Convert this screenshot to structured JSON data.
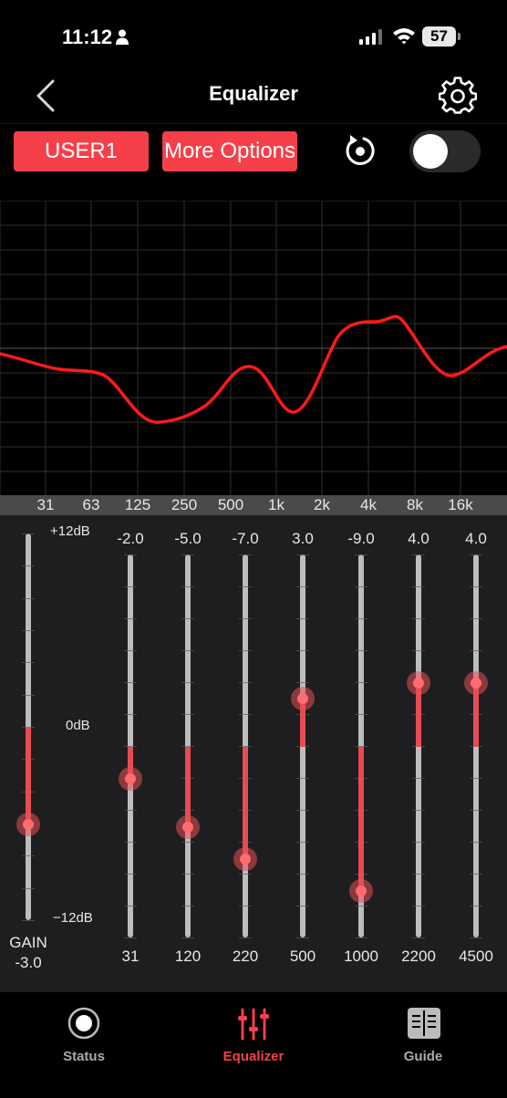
{
  "status": {
    "time": "11:12",
    "battery": "57"
  },
  "nav": {
    "title": "Equalizer"
  },
  "toolbar": {
    "preset_label": "USER1",
    "more_options_label": "More Options",
    "toggle_on": false
  },
  "graph": {
    "freq_labels": [
      "31",
      "63",
      "125",
      "250",
      "500",
      "1k",
      "2k",
      "4k",
      "8k",
      "16k"
    ]
  },
  "scale": {
    "top": "+12dB",
    "mid": "0dB",
    "bottom": "−12dB"
  },
  "gain": {
    "label": "GAIN",
    "value": "-3.0",
    "level": -3.0
  },
  "bands": [
    {
      "freq": "31",
      "value": "-2.0",
      "level": -2.0
    },
    {
      "freq": "120",
      "value": "-5.0",
      "level": -5.0
    },
    {
      "freq": "220",
      "value": "-7.0",
      "level": -7.0
    },
    {
      "freq": "500",
      "value": "3.0",
      "level": 3.0
    },
    {
      "freq": "1000",
      "value": "-9.0",
      "level": -9.0
    },
    {
      "freq": "2200",
      "value": "4.0",
      "level": 4.0
    },
    {
      "freq": "4500",
      "value": "4.0",
      "level": 4.0
    }
  ],
  "tabs": [
    {
      "label": "Status",
      "icon": "record-icon",
      "active": false
    },
    {
      "label": "Equalizer",
      "icon": "sliders-icon",
      "active": true
    },
    {
      "label": "Guide",
      "icon": "book-icon",
      "active": false
    }
  ],
  "colors": {
    "accent": "#f5404a",
    "curve": "#ff1a1a",
    "panel": "#1e1e20"
  }
}
